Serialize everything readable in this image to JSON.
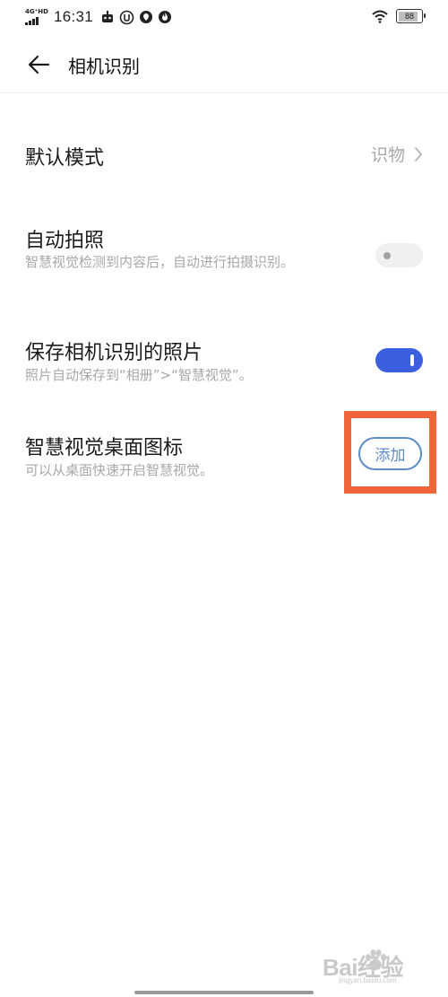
{
  "status_bar": {
    "network": "4G⁺HD",
    "time": "16:31",
    "icons": [
      "robot-icon",
      "u-badge-icon",
      "location-icon",
      "flame-icon",
      "wifi-icon"
    ],
    "battery": "88",
    "battery_level": 0.88
  },
  "header": {
    "title": "相机识别",
    "back_icon": "arrow-left-icon"
  },
  "settings": {
    "default_mode": {
      "label": "默认模式",
      "value": "识物"
    },
    "auto_photo": {
      "label": "自动拍照",
      "description": "智慧视觉检测到内容后，自动进行拍摄识别。",
      "enabled": false
    },
    "save_photos": {
      "label": "保存相机识别的照片",
      "description": "照片自动保存到“相册”>“智慧视觉”。",
      "enabled": true
    },
    "desktop_icon": {
      "label": "智慧视觉桌面图标",
      "description": "可以从桌面快速开启智慧视觉。",
      "button": "添加"
    }
  },
  "watermark": {
    "text": "Bai经验",
    "sub": "jingyan.baidu.com"
  },
  "colors": {
    "accent": "#3c5fe0",
    "highlight": "#f0663a",
    "button": "#5d8cc7"
  }
}
